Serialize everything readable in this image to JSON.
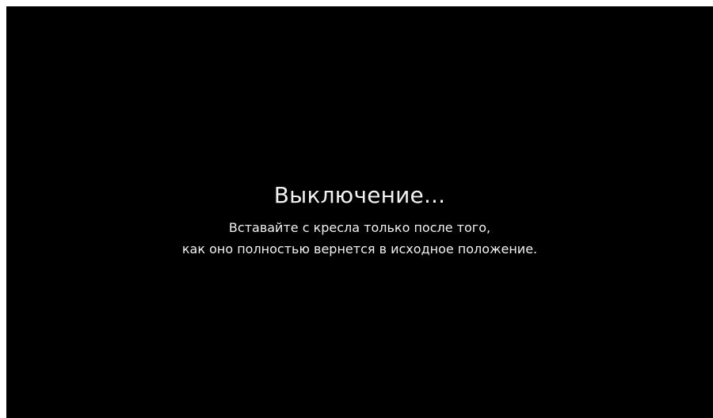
{
  "screen": {
    "background_color": "#000000",
    "text_color": "#f2f2f2",
    "title": "Выключение...",
    "message_lines": [
      "Вставайте с кресла только после того,",
      "как оно полностью вернется в исходное положение."
    ]
  }
}
